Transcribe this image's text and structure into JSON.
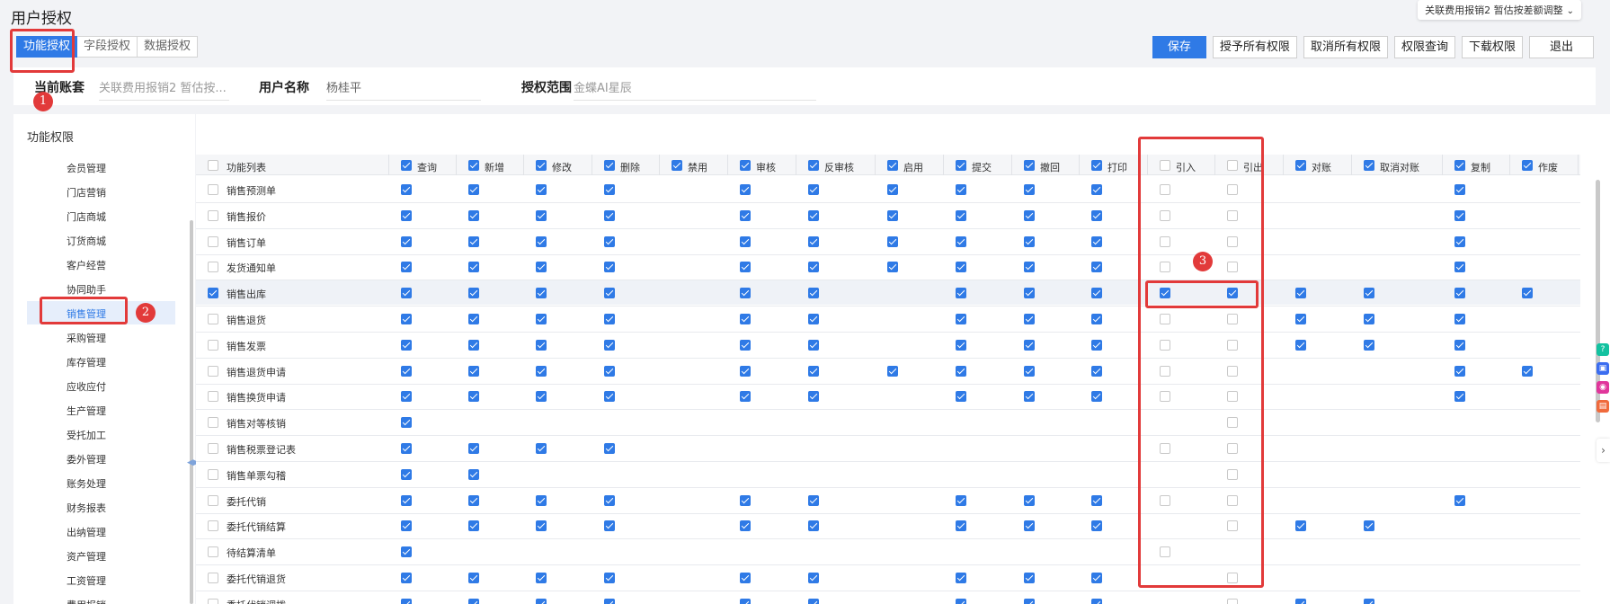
{
  "page": {
    "title": "用户授权"
  },
  "account_switch": {
    "label": "关联费用报销2 暂估按差额调整"
  },
  "tabs": [
    "功能授权",
    "字段授权",
    "数据授权"
  ],
  "buttons": {
    "save": "保存",
    "grant_all": "授予所有权限",
    "revoke_all": "取消所有权限",
    "query": "权限查询",
    "download": "下载权限",
    "exit": "退出"
  },
  "info": {
    "account_label": "当前账套",
    "account_value": "关联费用报销2 暂估按...",
    "user_label": "用户名称",
    "user_value": "杨桂平",
    "scope_label": "授权范围",
    "scope_value": "金蝶AI星辰"
  },
  "left_panel": {
    "title": "功能权限",
    "items": [
      "会员管理",
      "门店营销",
      "门店商城",
      "订货商城",
      "客户经营",
      "协同助手",
      "销售管理",
      "采购管理",
      "库存管理",
      "应收应付",
      "生产管理",
      "受托加工",
      "委外管理",
      "账务处理",
      "财务报表",
      "出纳管理",
      "资产管理",
      "工资管理",
      "费用报销"
    ],
    "selected_index": 6
  },
  "table": {
    "first_column": "功能列表",
    "columns": [
      {
        "label": "查询",
        "checked": true
      },
      {
        "label": "新增",
        "checked": true
      },
      {
        "label": "修改",
        "checked": true
      },
      {
        "label": "删除",
        "checked": true
      },
      {
        "label": "禁用",
        "checked": true
      },
      {
        "label": "审核",
        "checked": true
      },
      {
        "label": "反审核",
        "checked": true
      },
      {
        "label": "启用",
        "checked": true
      },
      {
        "label": "提交",
        "checked": true
      },
      {
        "label": "撤回",
        "checked": true
      },
      {
        "label": "打印",
        "checked": true
      },
      {
        "label": "引入",
        "checked": false
      },
      {
        "label": "引出",
        "checked": false
      },
      {
        "label": "对账",
        "checked": true
      },
      {
        "label": "取消对账",
        "checked": true
      },
      {
        "label": "复制",
        "checked": true
      },
      {
        "label": "作废",
        "checked": true
      }
    ],
    "rows": [
      {
        "name": "销售预测单",
        "row_checked": false,
        "cells": [
          1,
          1,
          1,
          1,
          "",
          1,
          1,
          1,
          1,
          1,
          1,
          0,
          0,
          "",
          "",
          1,
          ""
        ]
      },
      {
        "name": "销售报价",
        "row_checked": false,
        "cells": [
          1,
          1,
          1,
          1,
          "",
          1,
          1,
          1,
          1,
          1,
          1,
          0,
          0,
          "",
          "",
          1,
          ""
        ]
      },
      {
        "name": "销售订单",
        "row_checked": false,
        "cells": [
          1,
          1,
          1,
          1,
          "",
          1,
          1,
          1,
          1,
          1,
          1,
          0,
          0,
          "",
          "",
          1,
          ""
        ]
      },
      {
        "name": "发货通知单",
        "row_checked": false,
        "cells": [
          1,
          1,
          1,
          1,
          "",
          1,
          1,
          1,
          1,
          1,
          1,
          0,
          0,
          "",
          "",
          1,
          ""
        ]
      },
      {
        "name": "销售出库",
        "row_checked": true,
        "cells": [
          1,
          1,
          1,
          1,
          "",
          1,
          1,
          "",
          1,
          1,
          1,
          1,
          1,
          1,
          1,
          1,
          1
        ]
      },
      {
        "name": "销售退货",
        "row_checked": false,
        "cells": [
          1,
          1,
          1,
          1,
          "",
          1,
          1,
          "",
          1,
          1,
          1,
          0,
          0,
          1,
          1,
          1,
          ""
        ]
      },
      {
        "name": "销售发票",
        "row_checked": false,
        "cells": [
          1,
          1,
          1,
          1,
          "",
          1,
          1,
          "",
          1,
          1,
          1,
          0,
          0,
          1,
          1,
          1,
          ""
        ]
      },
      {
        "name": "销售退货申请",
        "row_checked": false,
        "cells": [
          1,
          1,
          1,
          1,
          "",
          1,
          1,
          1,
          1,
          1,
          1,
          0,
          0,
          "",
          "",
          1,
          1
        ]
      },
      {
        "name": "销售换货申请",
        "row_checked": false,
        "cells": [
          1,
          1,
          1,
          1,
          "",
          1,
          1,
          "",
          1,
          1,
          1,
          0,
          0,
          "",
          "",
          1,
          ""
        ]
      },
      {
        "name": "销售对等核销",
        "row_checked": false,
        "cells": [
          1,
          "",
          "",
          "",
          "",
          "",
          "",
          "",
          "",
          "",
          "",
          "",
          0,
          "",
          "",
          "",
          ""
        ]
      },
      {
        "name": "销售税票登记表",
        "row_checked": false,
        "cells": [
          1,
          1,
          1,
          1,
          "",
          "",
          "",
          "",
          "",
          "",
          "",
          0,
          0,
          "",
          "",
          "",
          ""
        ]
      },
      {
        "name": "销售单票勾稽",
        "row_checked": false,
        "cells": [
          1,
          1,
          "",
          "",
          "",
          "",
          "",
          "",
          "",
          "",
          "",
          "",
          0,
          "",
          "",
          "",
          ""
        ]
      },
      {
        "name": "委托代销",
        "row_checked": false,
        "cells": [
          1,
          1,
          1,
          1,
          "",
          1,
          1,
          "",
          1,
          1,
          1,
          0,
          0,
          "",
          "",
          1,
          ""
        ]
      },
      {
        "name": "委托代销结算",
        "row_checked": false,
        "cells": [
          1,
          1,
          1,
          1,
          "",
          1,
          1,
          "",
          1,
          1,
          1,
          "",
          0,
          1,
          1,
          "",
          ""
        ]
      },
      {
        "name": "待结算清单",
        "row_checked": false,
        "cells": [
          1,
          "",
          "",
          "",
          "",
          "",
          "",
          "",
          "",
          "",
          "",
          0,
          "",
          "",
          "",
          "",
          ""
        ]
      },
      {
        "name": "委托代销退货",
        "row_checked": false,
        "cells": [
          1,
          1,
          1,
          1,
          "",
          1,
          1,
          "",
          1,
          1,
          1,
          "",
          0,
          "",
          "",
          "",
          ""
        ]
      },
      {
        "name": "委托代销调拨",
        "row_checked": false,
        "cells": [
          1,
          1,
          1,
          1,
          "",
          1,
          1,
          "",
          1,
          1,
          1,
          "",
          0,
          1,
          1,
          "",
          ""
        ]
      }
    ]
  },
  "annotations": [
    "1",
    "2",
    "3"
  ],
  "side_icons": [
    {
      "icon": "help-icon",
      "color": "#13c2a0",
      "glyph": "?"
    },
    {
      "icon": "chat-icon",
      "color": "#3b6df0",
      "glyph": "▣"
    },
    {
      "icon": "message-icon",
      "color": "#e0369b",
      "glyph": "◉"
    },
    {
      "icon": "gift-icon",
      "color": "#f06a3c",
      "glyph": "▤"
    }
  ],
  "colors": {
    "accent": "#2f7ae6",
    "annotation": "#e23a3a",
    "selected_row": "#eff2f7"
  }
}
